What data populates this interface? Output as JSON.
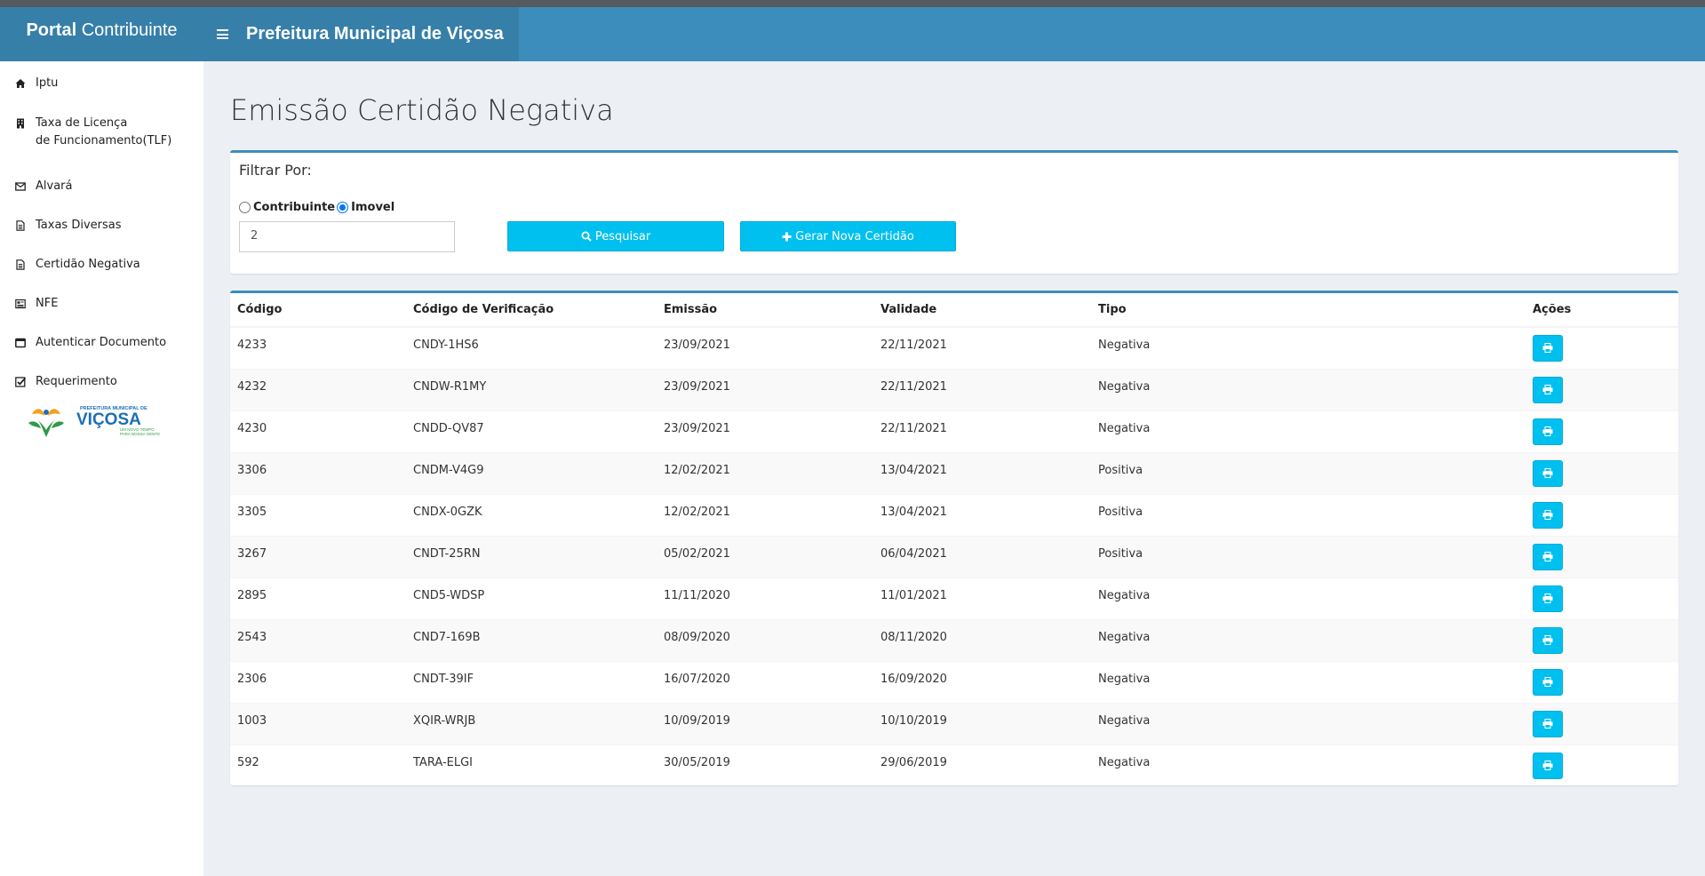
{
  "header": {
    "brand_bold": "Portal",
    "brand_rest": "Contribuinte",
    "title": "Prefeitura Municipal de Viçosa"
  },
  "sidebar": {
    "items": [
      {
        "label": "Iptu",
        "icon": "home-icon"
      },
      {
        "label_line1": "Taxa de Licença",
        "label_line2": "de Funcionamento(TLF)",
        "icon": "building-icon"
      },
      {
        "label": "Alvará",
        "icon": "envelope-icon"
      },
      {
        "label": "Taxas Diversas",
        "icon": "file-text-icon"
      },
      {
        "label": "Certidão Negativa",
        "icon": "file-text-icon"
      },
      {
        "label": "NFE",
        "icon": "newspaper-icon"
      },
      {
        "label": "Autenticar Documento",
        "icon": "window-icon"
      },
      {
        "label": "Requerimento",
        "icon": "check-square-icon"
      }
    ],
    "logo": {
      "line1": "PREFEITURA MUNICIPAL DE",
      "line2": "VIÇOSA",
      "line3": "UM NOVO TEMPO",
      "line4": "PARA NOSSA GENTE"
    }
  },
  "page": {
    "title": "Emissão Certidão Negativa"
  },
  "filter": {
    "label": "Filtrar Por:",
    "option_contribuinte": "Contribuinte",
    "option_imovel": "Imovel",
    "selected": "Imovel",
    "input_value": "2",
    "search_button": "Pesquisar",
    "generate_button": "Gerar Nova Certidão"
  },
  "table": {
    "headers": {
      "codigo": "Código",
      "verificacao": "Código de Verificação",
      "emissao": "Emissão",
      "validade": "Validade",
      "tipo": "Tipo",
      "acoes": "Ações"
    },
    "rows": [
      {
        "codigo": "4233",
        "verificacao": "CNDY-1HS6",
        "emissao": "23/09/2021",
        "validade": "22/11/2021",
        "tipo": "Negativa"
      },
      {
        "codigo": "4232",
        "verificacao": "CNDW-R1MY",
        "emissao": "23/09/2021",
        "validade": "22/11/2021",
        "tipo": "Negativa"
      },
      {
        "codigo": "4230",
        "verificacao": "CNDD-QV87",
        "emissao": "23/09/2021",
        "validade": "22/11/2021",
        "tipo": "Negativa"
      },
      {
        "codigo": "3306",
        "verificacao": "CNDM-V4G9",
        "emissao": "12/02/2021",
        "validade": "13/04/2021",
        "tipo": "Positiva"
      },
      {
        "codigo": "3305",
        "verificacao": "CNDX-0GZK",
        "emissao": "12/02/2021",
        "validade": "13/04/2021",
        "tipo": "Positiva"
      },
      {
        "codigo": "3267",
        "verificacao": "CNDT-25RN",
        "emissao": "05/02/2021",
        "validade": "06/04/2021",
        "tipo": "Positiva"
      },
      {
        "codigo": "2895",
        "verificacao": "CND5-WDSP",
        "emissao": "11/11/2020",
        "validade": "11/01/2021",
        "tipo": "Negativa"
      },
      {
        "codigo": "2543",
        "verificacao": "CND7-169B",
        "emissao": "08/09/2020",
        "validade": "08/11/2020",
        "tipo": "Negativa"
      },
      {
        "codigo": "2306",
        "verificacao": "CNDT-39IF",
        "emissao": "16/07/2020",
        "validade": "16/09/2020",
        "tipo": "Negativa"
      },
      {
        "codigo": "1003",
        "verificacao": "XQIR-WRJB",
        "emissao": "10/09/2019",
        "validade": "10/10/2019",
        "tipo": "Negativa"
      },
      {
        "codigo": "592",
        "verificacao": "TARA-ELGI",
        "emissao": "30/05/2019",
        "validade": "29/06/2019",
        "tipo": "Negativa"
      }
    ],
    "action_icon": "print-icon"
  },
  "colors": {
    "header": "#3c8dbc",
    "header_dark": "#367fa9",
    "button": "#00c0ef",
    "background": "#ecf0f5"
  }
}
